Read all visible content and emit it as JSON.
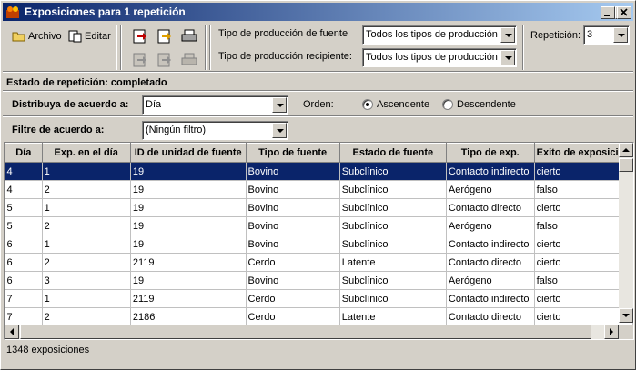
{
  "window": {
    "title": "Exposiciones para 1 repetición"
  },
  "toolbar": {
    "archivo": "Archivo",
    "editar": "Editar",
    "source_type_label": "Tipo de producción de fuente",
    "source_type_value": "Todos los tipos de producción",
    "recipient_type_label": "Tipo de producción recipiente:",
    "recipient_type_value": "Todos los tipos de producción",
    "repetition_label": "Repetición:",
    "repetition_value": "3"
  },
  "status_line": "Estado de repetición: completado",
  "sort": {
    "label": "Distribuya de acuerdo a:",
    "value": "Día",
    "order_label": "Orden:",
    "ascending": "Ascendente",
    "descending": "Descendente",
    "selected": "Ascendente"
  },
  "filter": {
    "label": "Filtre de acuerdo a:",
    "value": "(Ningún filtro)"
  },
  "table": {
    "columns": [
      "Día",
      "Exp. en el día",
      "ID de unidad de fuente",
      "Tipo de fuente",
      "Estado de fuente",
      "Tipo de exp.",
      "Exito de exposición"
    ],
    "rows": [
      [
        "4",
        "1",
        "19",
        "Bovino",
        "Subclínico",
        "Contacto indirecto",
        "cierto"
      ],
      [
        "4",
        "2",
        "19",
        "Bovino",
        "Subclínico",
        "Aerógeno",
        "falso"
      ],
      [
        "5",
        "1",
        "19",
        "Bovino",
        "Subclínico",
        "Contacto directo",
        "cierto"
      ],
      [
        "5",
        "2",
        "19",
        "Bovino",
        "Subclínico",
        "Aerógeno",
        "falso"
      ],
      [
        "6",
        "1",
        "19",
        "Bovino",
        "Subclínico",
        "Contacto indirecto",
        "cierto"
      ],
      [
        "6",
        "2",
        "2119",
        "Cerdo",
        "Latente",
        "Contacto directo",
        "cierto"
      ],
      [
        "6",
        "3",
        "19",
        "Bovino",
        "Subclínico",
        "Aerógeno",
        "falso"
      ],
      [
        "7",
        "1",
        "2119",
        "Cerdo",
        "Subclínico",
        "Contacto indirecto",
        "cierto"
      ],
      [
        "7",
        "2",
        "2186",
        "Cerdo",
        "Latente",
        "Contacto directo",
        "cierto"
      ]
    ],
    "selected_row": 0
  },
  "footer": {
    "count": "1348 exposiciones"
  }
}
